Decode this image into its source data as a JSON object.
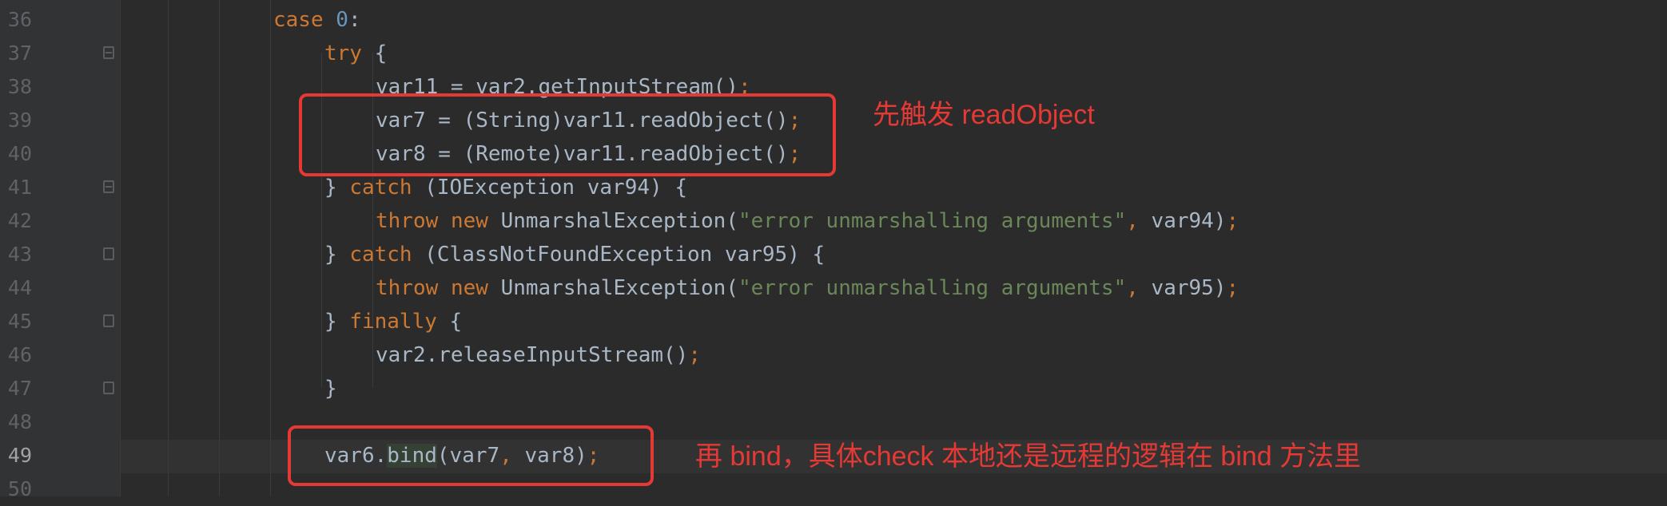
{
  "editor": {
    "line_numbers": [
      "36",
      "37",
      "38",
      "39",
      "40",
      "41",
      "42",
      "43",
      "44",
      "45",
      "46",
      "47",
      "48",
      "49",
      "50"
    ],
    "lines": {
      "l36": {
        "kw": "case",
        "num": "0",
        "rest": ":"
      },
      "l37": {
        "kw": "try",
        "rest": " {"
      },
      "l38": {
        "text": "var11 = var2.getInputStream()",
        "semi": ";"
      },
      "l39": {
        "text": "var7 = (String)var11.readObject()",
        "semi": ";"
      },
      "l40": {
        "text": "var8 = (Remote)var11.readObject()",
        "semi": ";"
      },
      "l41": {
        "pre": "} ",
        "kw": "catch",
        "rest": " (IOException var94) {"
      },
      "l42": {
        "kw1": "throw",
        "kw2": "new",
        "call": "UnmarshalException(",
        "str": "\"error unmarshalling arguments\"",
        "comma": ",",
        "arg": " var94)",
        "semi": ";"
      },
      "l43": {
        "pre": "} ",
        "kw": "catch",
        "rest": " (ClassNotFoundException var95) {"
      },
      "l44": {
        "kw1": "throw",
        "kw2": "new",
        "call": "UnmarshalException(",
        "str": "\"error unmarshalling arguments\"",
        "comma": ",",
        "arg": " var95)",
        "semi": ";"
      },
      "l45": {
        "pre": "} ",
        "kw": "finally",
        "rest": " {"
      },
      "l46": {
        "text": "var2.releaseInputStream()",
        "semi": ";"
      },
      "l47": {
        "text": "}"
      },
      "l49": {
        "obj": "var6.",
        "method": "bind",
        "args1": "(var7",
        "comma": ",",
        "args2": " var8)",
        "semi": ";"
      }
    }
  },
  "annotations": {
    "first": "先触发 readObject",
    "second": "再 bind，具体check 本地还是远程的逻辑在 bind 方法里"
  },
  "colors": {
    "background": "#2b2b2b",
    "keyword": "#cc7832",
    "string": "#6a8759",
    "number": "#6897bb",
    "annotation": "#e53935"
  }
}
